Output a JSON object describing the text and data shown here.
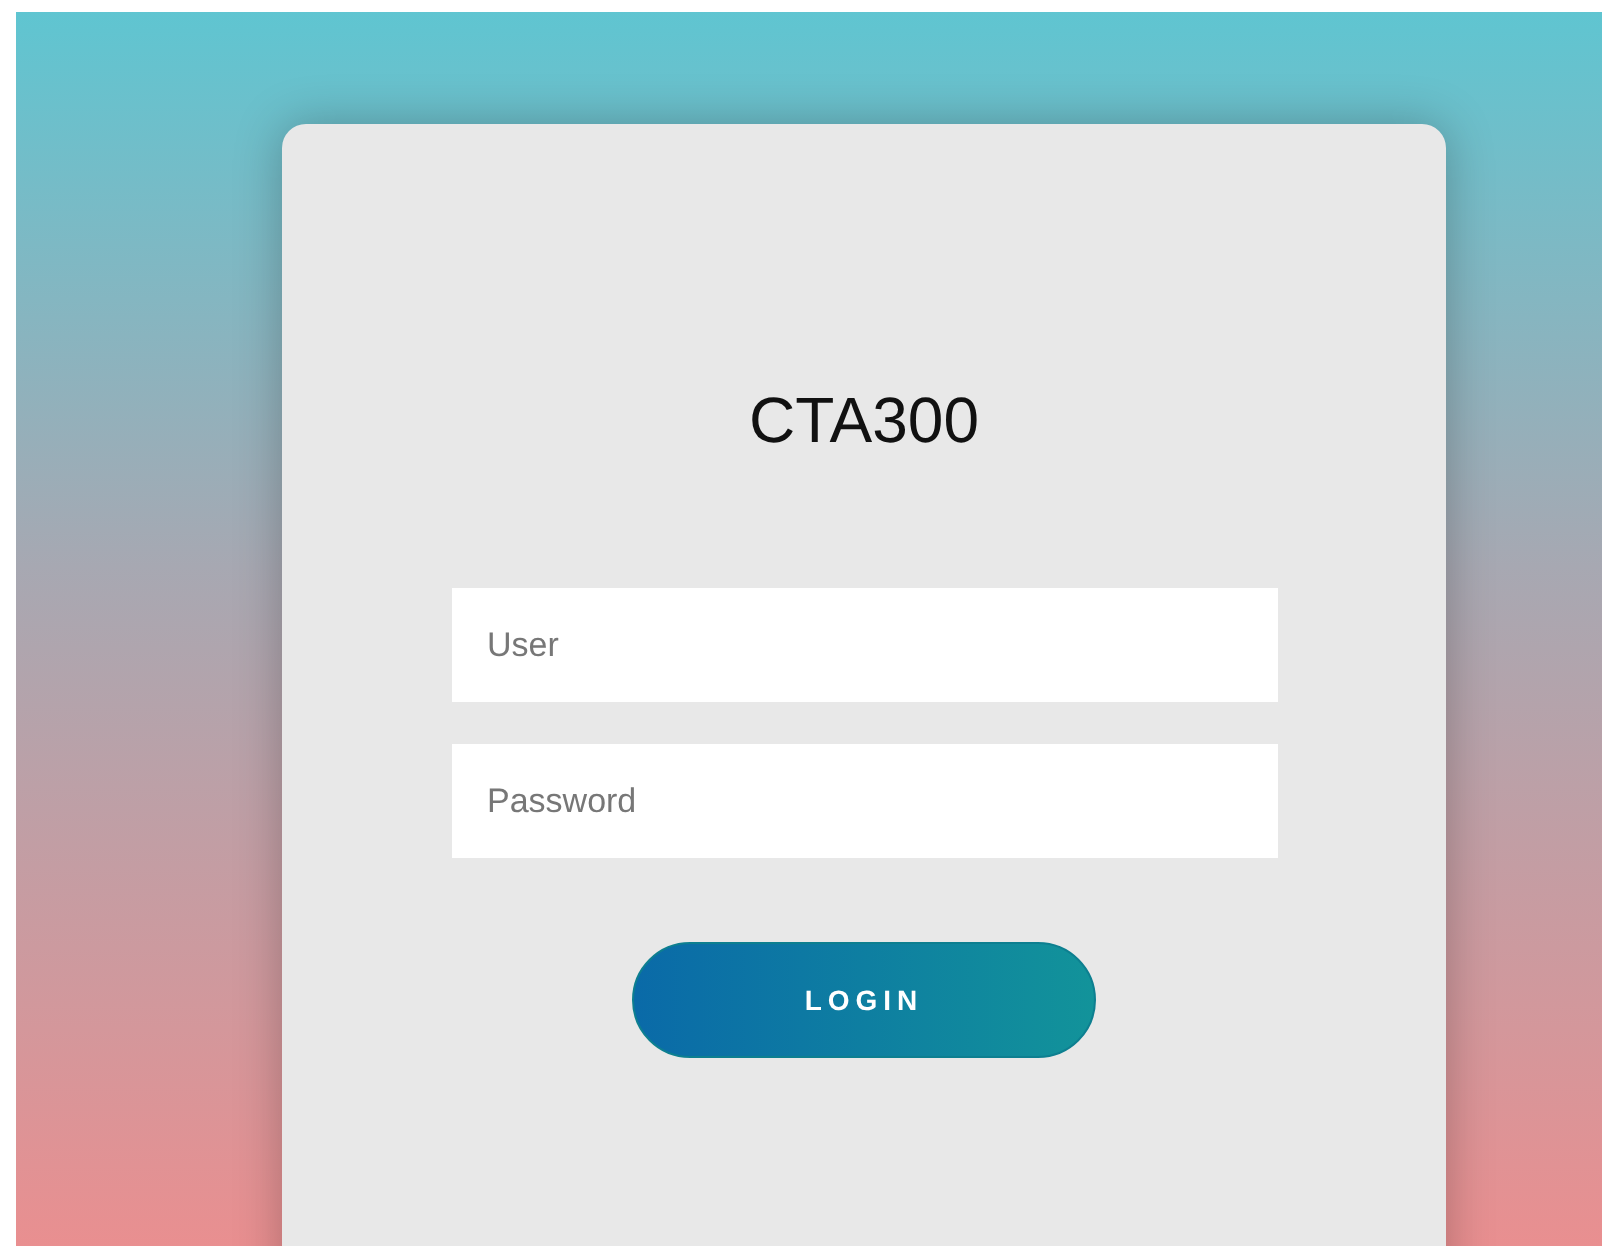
{
  "title": "CTA300",
  "fields": [
    {
      "placeholder": "User"
    },
    {
      "placeholder": "Password"
    }
  ],
  "button": "LOGIN"
}
